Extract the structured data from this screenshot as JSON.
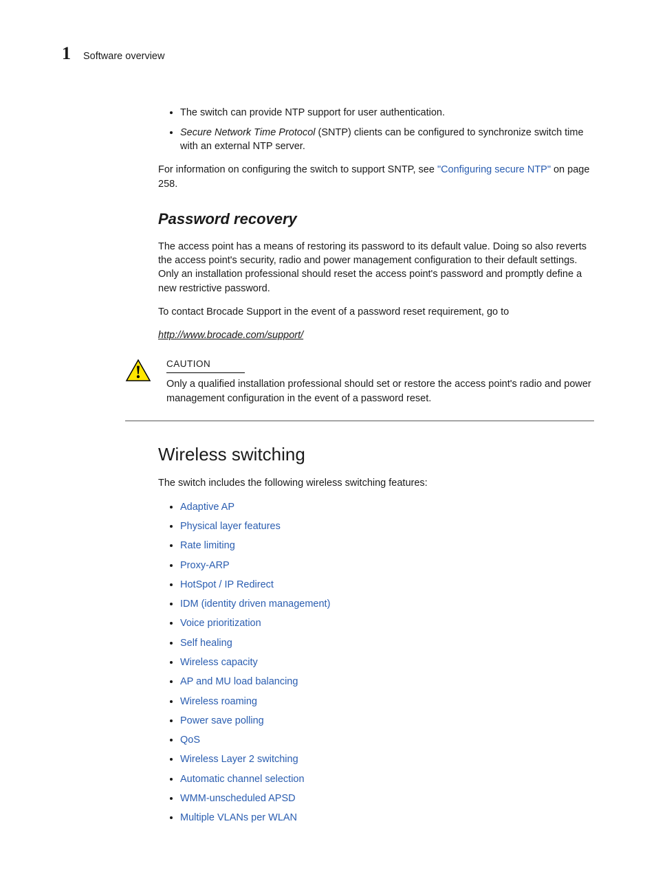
{
  "header": {
    "chapter_number": "1",
    "chapter_title": "Software overview"
  },
  "intro_bullets": {
    "b1": "The switch can provide NTP support for user authentication.",
    "b2_italic": "Secure Network Time Protocol",
    "b2_rest": " (SNTP) clients can be configured to synchronize switch time with an external NTP server."
  },
  "intro_para": {
    "prefix": "For information on configuring the switch to support SNTP, see ",
    "link": "\"Configuring secure NTP\"",
    "suffix": " on page 258."
  },
  "password_recovery": {
    "heading": "Password recovery",
    "p1": "The access point has a means of restoring its password to its default value. Doing so also reverts the access point's security, radio and power management configuration to their default settings. Only an installation professional should reset the access point's password and promptly define a new restrictive password.",
    "p2": "To contact Brocade Support in the event of a password reset requirement, go to",
    "url": "http://www.brocade.com/support/"
  },
  "caution": {
    "label": "CAUTION",
    "text": "Only a qualified installation professional should set or restore the access point's radio and power management configuration in the event of a password reset."
  },
  "wireless": {
    "heading": "Wireless switching",
    "intro": "The switch includes the following wireless switching features:",
    "items": [
      "Adaptive AP",
      "Physical layer features",
      "Rate limiting",
      "Proxy-ARP",
      "HotSpot / IP Redirect",
      "IDM (identity driven management)",
      "Voice prioritization",
      "Self healing",
      "Wireless capacity",
      "AP and MU load balancing",
      "Wireless roaming",
      "Power save polling",
      "QoS",
      "Wireless Layer 2 switching",
      "Automatic channel selection",
      "WMM-unscheduled APSD",
      "Multiple VLANs per WLAN"
    ]
  }
}
